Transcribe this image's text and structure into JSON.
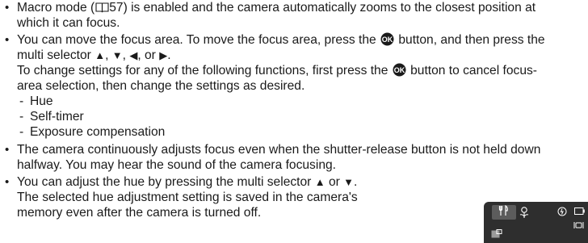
{
  "bullets": {
    "macro": {
      "line1_before": "Macro mode (",
      "line1_page": "57",
      "line1_after": ") is enabled and the camera automatically zooms to the closest position at",
      "line2": "which it can focus."
    },
    "focus_area": {
      "line1_before": "You can move the focus area. To move the focus area, press the",
      "line1_after": "button, and then press the",
      "line2_before": "multi selector",
      "comma1": ",",
      "comma2": ",",
      "or_text": ", or",
      "period": ".",
      "para_line1_before": "To change settings for any of the following functions, first press the",
      "para_line1_after": "button to cancel focus-",
      "para_line2": "area selection, then change the settings as desired.",
      "functions": [
        "Hue",
        "Self-timer",
        "Exposure compensation"
      ]
    },
    "continuous": {
      "line1": "The camera continuously adjusts focus even when the shutter-release button is not held down",
      "line2": "halfway. You may hear the sound of the camera focusing."
    },
    "hue": {
      "line1_before": "You can adjust the hue by pressing the multi selector",
      "line1_or": "or",
      "line1_end": ".",
      "line2": "The selected hue adjustment setting is saved in the camera's",
      "line3": "memory even after the camera is turned off."
    }
  },
  "icons": {
    "ok_button": "ok-button-icon",
    "book": "book-reference-icon",
    "arrows": {
      "up": "▲",
      "down": "▼",
      "left": "◀",
      "right": "▶"
    }
  },
  "colors": {
    "text": "#1a1a1a",
    "screen_bg": "#2e2e2e",
    "badge_bg": "#5c5c5c"
  }
}
